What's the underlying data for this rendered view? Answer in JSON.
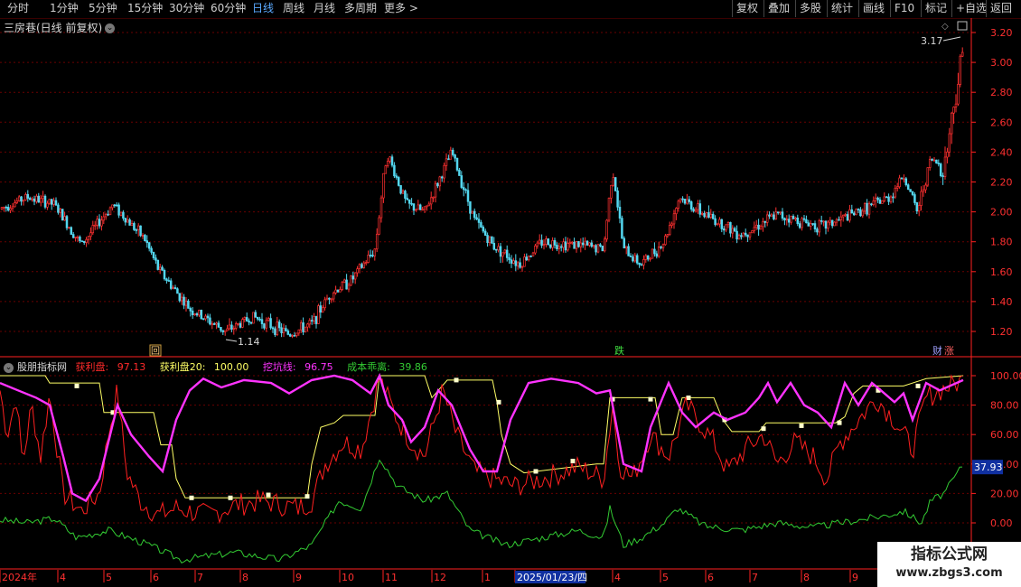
{
  "toolbar": {
    "periods": [
      "分时",
      "1分钟",
      "5分钟",
      "15分钟",
      "30分钟",
      "60分钟",
      "日线",
      "周线",
      "月线",
      "多周期",
      "更多 >"
    ],
    "active_period": "日线",
    "right_buttons": [
      "复权",
      "叠加",
      "多股",
      "统计",
      "画线",
      "F10",
      "标记",
      "+自选",
      "返回"
    ]
  },
  "price_panel": {
    "title": "三房巷(日线 前复权)",
    "collapse_icon": "chevron-down-icon",
    "high_label": "3.17",
    "low_label": "1.14",
    "axis_ticks": [
      "3.20",
      "3.00",
      "2.80",
      "2.60",
      "2.40",
      "2.20",
      "2.00",
      "1.80",
      "1.60",
      "1.40",
      "1.20"
    ],
    "markers": {
      "hui": "回",
      "die": "跌",
      "cai": "财",
      "zhang": "涨"
    }
  },
  "indicator_panel": {
    "name": "股朋指标网",
    "lines": [
      {
        "label": "获利盘:",
        "value": "97.13",
        "color": "#ff2a2a"
      },
      {
        "label": "获利盘20:",
        "value": "100.00",
        "color": "#ffff66"
      },
      {
        "label": "挖坑线:",
        "value": "96.75",
        "color": "#ff33ff"
      },
      {
        "label": "成本乖离:",
        "value": "39.86",
        "color": "#33cc33"
      }
    ],
    "axis_ticks": [
      "100.00",
      "80.00",
      "60.00",
      "40.00",
      "20.00",
      "0.00"
    ],
    "current_value": "37.93"
  },
  "date_axis": {
    "labels": [
      "2024年",
      "4",
      "5",
      "6",
      "7",
      "8",
      "9",
      "10",
      "11",
      "12",
      "1",
      "2025/01/23/四",
      "4",
      "5",
      "6",
      "7",
      "8",
      "9"
    ]
  },
  "watermark": {
    "line1": "指标公式网",
    "line2": "www.zbgs3.com"
  },
  "colors": {
    "up": "#ff3030",
    "down": "#54d8f0",
    "grid": "#6a0000",
    "axis": "#ff2020"
  }
}
